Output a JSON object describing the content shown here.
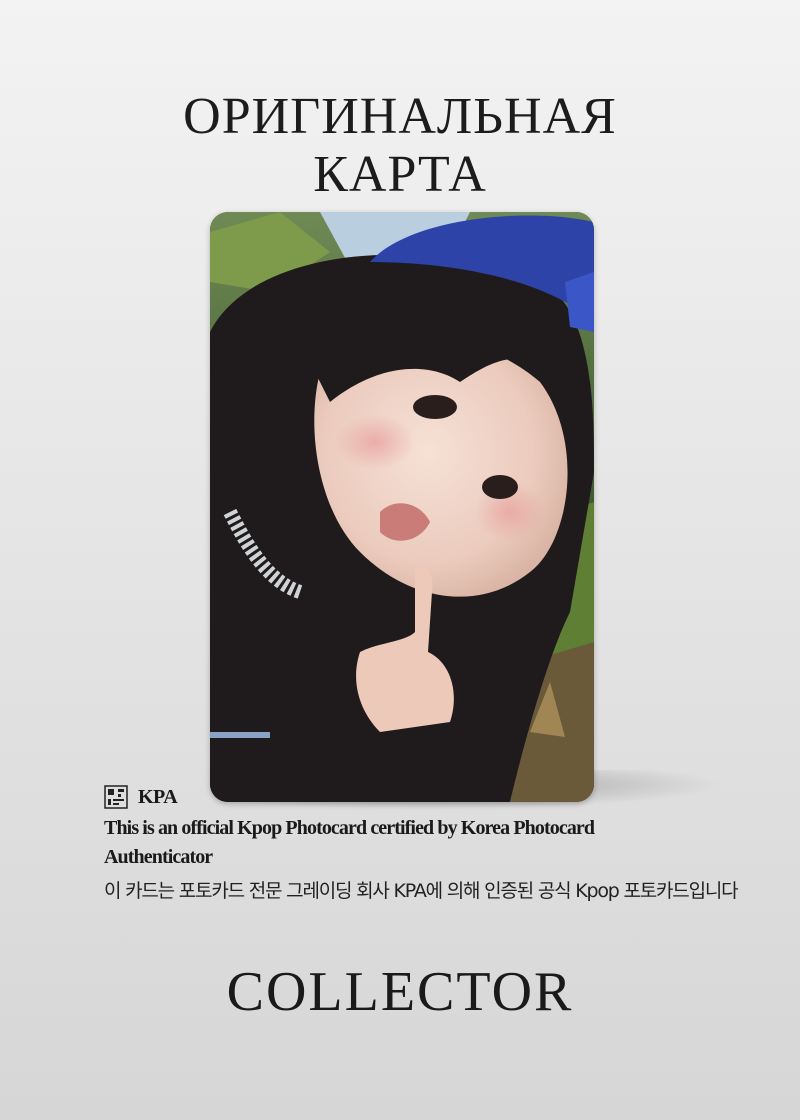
{
  "header": {
    "title_line1": "ОРИГИНАЛЬНАЯ",
    "title_line2": "КАРТА"
  },
  "photocard": {
    "image_description": "selfie photo of a girl with long dark hair, blue cap, jeweled necklace, finger near lips, palm trees behind"
  },
  "certification": {
    "brand": "KPA",
    "text_en": "This is an official Kpop Photocard certified by Korea Photocard Authenticator",
    "text_ko": "이 카드는 포토카드 전문 그레이딩 회사 KPA에 의해 인증된 공식 Kpop 포토카드입니다"
  },
  "footer": {
    "label": "COLLECTOR"
  }
}
